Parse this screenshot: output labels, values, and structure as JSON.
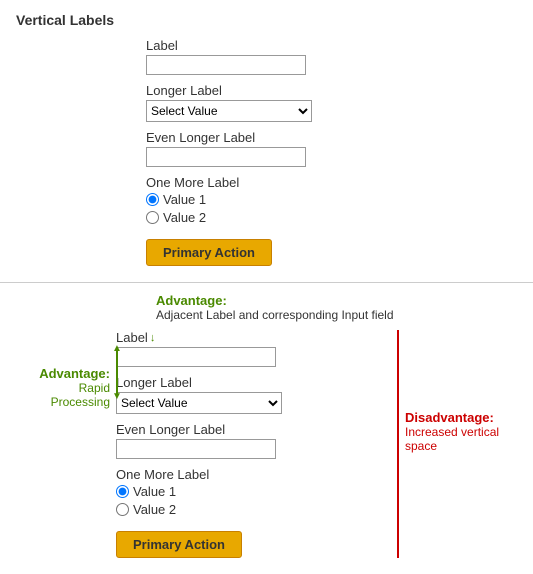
{
  "section1": {
    "title": "Vertical Labels",
    "fields": [
      {
        "label": "Label",
        "type": "input",
        "id": "label1"
      },
      {
        "label": "Longer Label",
        "type": "select",
        "id": "longer1",
        "placeholder": "Select Value"
      },
      {
        "label": "Even Longer Label",
        "type": "input",
        "id": "even1"
      },
      {
        "label": "One More Label",
        "type": "radio",
        "id": "more1"
      }
    ],
    "radio_options": [
      "Value 1",
      "Value 2"
    ],
    "button_label": "Primary Action"
  },
  "section2": {
    "advantage_top_label": "Advantage:",
    "advantage_top_sub": "Adjacent Label and corresponding Input field",
    "advantage_left_label": "Advantage:",
    "advantage_left_sub": "Rapid Processing",
    "disadvantage_label": "Disadvantage:",
    "disadvantage_sub": "Increased vertical space",
    "fields": [
      {
        "label": "Label",
        "type": "input",
        "has_arrow": true
      },
      {
        "label": "Longer Label",
        "type": "select",
        "placeholder": "Select Value"
      },
      {
        "label": "Even Longer Label",
        "type": "input"
      },
      {
        "label": "One More Label",
        "type": "radio"
      }
    ],
    "radio_options": [
      "Value 1",
      "Value 2"
    ],
    "button_label": "Primary Action"
  }
}
